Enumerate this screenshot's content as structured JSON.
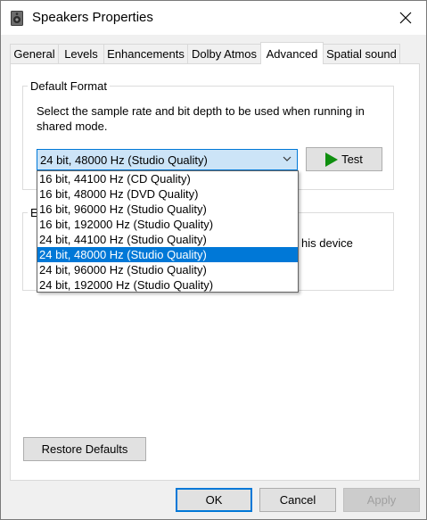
{
  "window": {
    "title": "Speakers Properties",
    "icon": "speaker-icon",
    "close_icon": "close-icon"
  },
  "tabs": [
    {
      "label": "General",
      "active": false
    },
    {
      "label": "Levels",
      "active": false
    },
    {
      "label": "Enhancements",
      "active": false
    },
    {
      "label": "Dolby Atmos",
      "active": false
    },
    {
      "label": "Advanced",
      "active": true
    },
    {
      "label": "Spatial sound",
      "active": false
    }
  ],
  "default_format": {
    "group_label": "Default Format",
    "description": "Select the sample rate and bit depth to be used when running in shared mode.",
    "selected_value": "24 bit, 48000 Hz (Studio Quality)",
    "test_label": "Test",
    "options": [
      "16 bit, 44100 Hz (CD Quality)",
      "16 bit, 48000 Hz (DVD Quality)",
      "16 bit, 96000 Hz (Studio Quality)",
      "16 bit, 192000 Hz (Studio Quality)",
      "24 bit, 44100 Hz (Studio Quality)",
      "24 bit, 48000 Hz (Studio Quality)",
      "24 bit, 96000 Hz (Studio Quality)",
      "24 bit, 192000 Hz (Studio Quality)"
    ],
    "highlighted_index": 5
  },
  "exclusive_mode": {
    "group_label_fragment": "E",
    "text_fragment": "his device"
  },
  "restore_defaults_label": "Restore Defaults",
  "footer": {
    "ok_label": "OK",
    "cancel_label": "Cancel",
    "apply_label": "Apply"
  },
  "colors": {
    "accent": "#0078d7",
    "selection_bg": "#cce4f7",
    "play_green": "#0f8f0f"
  }
}
